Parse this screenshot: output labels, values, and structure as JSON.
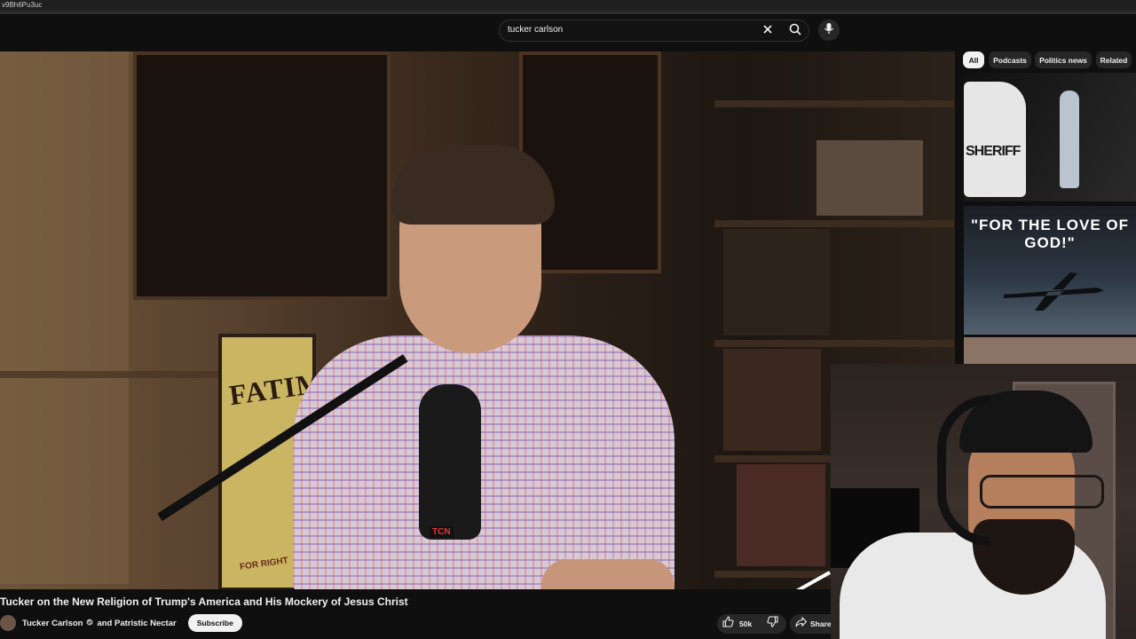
{
  "browser": {
    "url_fragment": "v9Bh6Pu3uc"
  },
  "search": {
    "query": "tucker carlson"
  },
  "icons": {
    "clear": "close-icon",
    "search": "search-icon",
    "mic": "microphone-icon",
    "like": "thumbs-up-icon",
    "dislike": "thumbs-down-icon",
    "share": "share-icon",
    "verified": "verified-icon"
  },
  "chips": [
    {
      "label": "All",
      "active": true
    },
    {
      "label": "Podcasts",
      "active": false
    },
    {
      "label": "Politics news",
      "active": false
    },
    {
      "label": "Related",
      "active": false
    }
  ],
  "recommendations": [
    {
      "thumbnail_text": "SHERIFF"
    },
    {
      "thumbnail_text": "\"FOR THE LOVE OF GOD!\""
    },
    {
      "thumbnail_text": ""
    }
  ],
  "player": {
    "poster_text": "FATIM",
    "poster_subtext": "FOR RIGHT",
    "mic_brand": "TCN"
  },
  "video": {
    "title": "Tucker on the New Religion of Trump's America and His Mockery of Jesus Christ",
    "channel": "Tucker Carlson",
    "collaborator": "and Patristic Nectar",
    "subscribe_label": "Subscribe",
    "likes": "50k",
    "share_label": "Share"
  },
  "colors": {
    "background": "#0f0f0f",
    "chip_bg": "#272727",
    "chip_active_bg": "#f1f1f1",
    "text": "#f1f1f1"
  }
}
